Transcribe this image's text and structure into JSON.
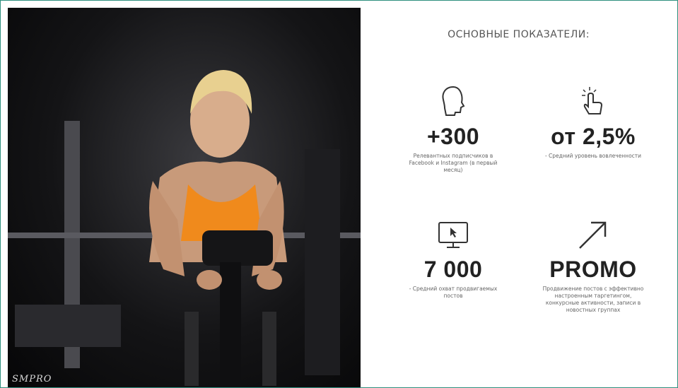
{
  "heading": "ОСНОВНЫЕ ПОКАЗАТЕЛИ:",
  "photo": {
    "caption": "SMPRO",
    "description": ""
  },
  "stats": [
    {
      "icon": "head-icon",
      "value": "+300",
      "desc": "Релевантных подписчиков в Facebook и Instagram (в первый месяц)"
    },
    {
      "icon": "pointer-click-icon",
      "value": "от 2,5%",
      "desc": "- Средний уровень вовлеченности"
    },
    {
      "icon": "monitor-cursor-icon",
      "value": "7 000",
      "desc": "- Средний охват продвигаемых постов"
    },
    {
      "icon": "arrow-up-right-icon",
      "value": "PROMO",
      "desc": "Продвижение постов с эффективно настроенным таргетингом, конкурсные активности, записи в новостных группах"
    }
  ],
  "colors": {
    "border": "#2f8f7f",
    "value_text": "#222222",
    "icon_stroke": "#333333",
    "shirt": "#f08a1c"
  }
}
